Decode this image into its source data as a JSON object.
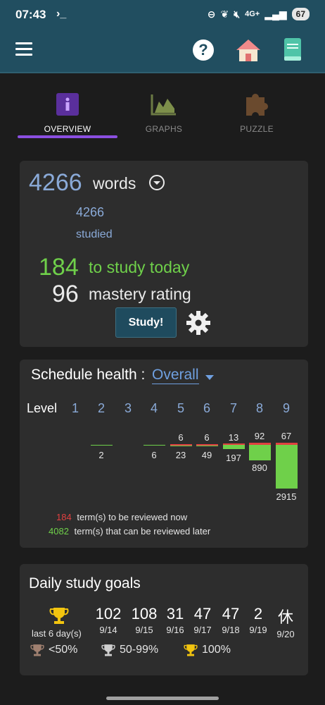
{
  "status_bar": {
    "time": "07:43",
    "prompt": "›_",
    "signal": "4G+",
    "battery": "67"
  },
  "tabs": [
    {
      "label": "OVERVIEW"
    },
    {
      "label": "GRAPHS"
    },
    {
      "label": "PUZZLE"
    }
  ],
  "overview": {
    "words_count": "4266",
    "words_label": "words",
    "studied_count": "4266",
    "studied_label": "studied",
    "today_count": "184",
    "today_label": "to study today",
    "mastery_value": "96",
    "mastery_label": "mastery rating",
    "study_button": "Study!"
  },
  "health": {
    "title": "Schedule health :",
    "selector_value": "Overall",
    "level_label": "Level",
    "levels": [
      "1",
      "2",
      "3",
      "4",
      "5",
      "6",
      "7",
      "8",
      "9"
    ],
    "due_counts": [
      "",
      "",
      "",
      "",
      "6",
      "6",
      "13",
      "92",
      "67"
    ],
    "later_counts": [
      "",
      "2",
      "",
      "6",
      "23",
      "49",
      "197",
      "890",
      "2915"
    ],
    "legend_due_count": "184",
    "legend_due_text": "term(s) to be reviewed now",
    "legend_later_count": "4082",
    "legend_later_text": "term(s) that can be reviewed later",
    "colors": {
      "due": "#e04040",
      "later": "#6fd04a"
    }
  },
  "goals": {
    "title": "Daily study goals",
    "last_days_label": "last 6 day(s)",
    "days": [
      {
        "value": "102",
        "date": "9/14"
      },
      {
        "value": "108",
        "date": "9/15"
      },
      {
        "value": "31",
        "date": "9/16"
      },
      {
        "value": "47",
        "date": "9/17"
      },
      {
        "value": "47",
        "date": "9/18"
      },
      {
        "value": "2",
        "date": "9/19"
      },
      {
        "value": "休",
        "date": "9/20"
      }
    ],
    "legend": [
      {
        "icon": "bronze-trophy-icon",
        "label": "<50%"
      },
      {
        "icon": "silver-trophy-icon",
        "label": "50-99%"
      },
      {
        "icon": "gold-trophy-icon",
        "label": "100%"
      }
    ]
  }
}
